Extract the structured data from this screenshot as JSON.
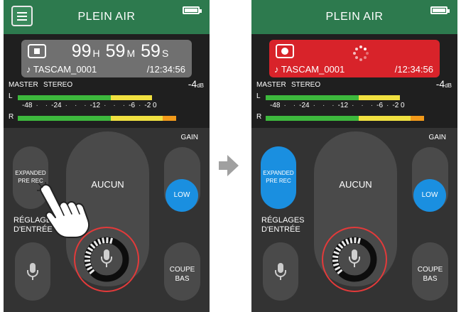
{
  "left_screen": {
    "title": "PLEIN AIR",
    "state": "stopped",
    "counter": {
      "hours": "99",
      "h_unit": "H",
      "minutes": "59",
      "m_unit": "M",
      "seconds": "59",
      "s_unit": "S",
      "filename": "♪ TASCAM_0001",
      "total_time": "/12:34:56"
    },
    "meter": {
      "master_label": "MASTER",
      "mode_label": "STEREO",
      "level_value": "-4",
      "level_unit": "dB",
      "channel_l": "L",
      "channel_r": "R",
      "scale": [
        "-48",
        "-24",
        "-12",
        "-6",
        "-2",
        "0"
      ]
    },
    "pre_rec_label": "EXPANDED PRE REC",
    "pre_rec_active": false,
    "scene_label": "AUCUN",
    "gain_label": "GAIN",
    "gain_value": "LOW",
    "input_settings_label": "RÉGLAGES D'ENTRÉE",
    "low_cut_label": "COUPE BAS"
  },
  "right_screen": {
    "title": "PLEIN AIR",
    "state": "recording",
    "counter": {
      "filename": "♪ TASCAM_0001",
      "total_time": "/12:34:56"
    },
    "meter": {
      "master_label": "MASTER",
      "mode_label": "STEREO",
      "level_value": "-4",
      "level_unit": "dB",
      "channel_l": "L",
      "channel_r": "R",
      "scale": [
        "-48",
        "-24",
        "-12",
        "-6",
        "-2",
        "0"
      ]
    },
    "pre_rec_label": "EXPANDED PRE REC",
    "pre_rec_active": true,
    "scene_label": "AUCUN",
    "gain_label": "GAIN",
    "gain_value": "LOW",
    "input_settings_label": "RÉGLAGES D'ENTRÉE",
    "low_cut_label": "COUPE BAS"
  },
  "meter_levels": {
    "left": 0.72,
    "right": 0.85
  },
  "colors": {
    "header_green": "#2d7a4e",
    "stopped_gray": "#707070",
    "recording_red": "#d8232a",
    "accent_blue": "#1a8fe0",
    "meter_green": "#3db83d",
    "meter_yellow": "#f0e040",
    "meter_orange": "#f29a1a",
    "knob_ring_red": "#e33a3a"
  },
  "icons": {
    "menu": "hamburger-menu-icon",
    "battery": "battery-icon",
    "stop": "stop-icon",
    "record": "record-icon",
    "busy": "spinner-icon",
    "mic": "microphone-icon",
    "arrow": "right-arrow-icon",
    "hand": "pointing-hand-icon"
  }
}
